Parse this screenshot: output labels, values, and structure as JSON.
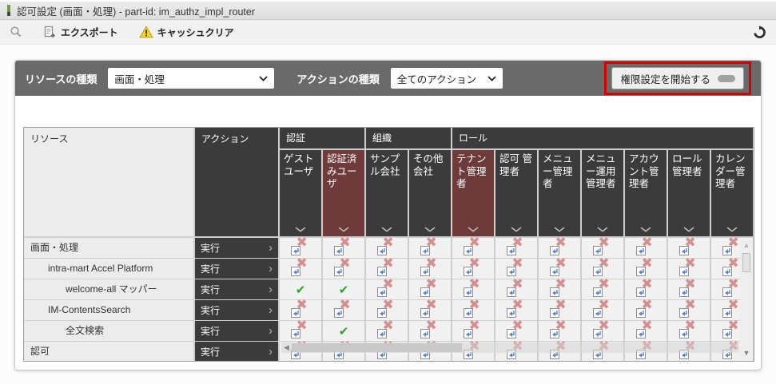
{
  "window": {
    "title": "認可設定 (画面・処理) - part-id: im_authz_impl_router"
  },
  "toolbar": {
    "export_label": "エクスポート",
    "cache_clear_label": "キャッシュクリア"
  },
  "filters": {
    "resource_type_label": "リソースの種類",
    "resource_type_value": "画面・処理",
    "action_type_label": "アクションの種類",
    "action_type_value": "全てのアクション",
    "start_button_label": "権限設定を開始する"
  },
  "table": {
    "resource_header": "リソース",
    "action_header": "アクション",
    "groups": [
      {
        "label": "認証",
        "columns": [
          {
            "label": "ゲストユーザ",
            "selected": false
          },
          {
            "label": "認証済みユーザ",
            "selected": true
          }
        ]
      },
      {
        "label": "組織",
        "columns": [
          {
            "label": "サンプル会社",
            "selected": false
          },
          {
            "label": "その他会社",
            "selected": false
          }
        ]
      },
      {
        "label": "ロール",
        "columns": [
          {
            "label": "テナント管理者",
            "selected": true
          },
          {
            "label": "認可 管理者",
            "selected": false
          },
          {
            "label": "メニュー管理者",
            "selected": false
          },
          {
            "label": "メニュー運用管理者",
            "selected": false
          },
          {
            "label": "アカウント管理者",
            "selected": false
          },
          {
            "label": "ロール管理者",
            "selected": false
          },
          {
            "label": "カレンダー管理者",
            "selected": false
          }
        ]
      }
    ],
    "rows": [
      {
        "resource": "画面・処理",
        "indent": 0,
        "action": "実行",
        "cells": [
          "deny",
          "deny",
          "deny",
          "deny",
          "deny",
          "deny",
          "deny",
          "deny",
          "deny",
          "deny",
          "deny"
        ]
      },
      {
        "resource": "intra-mart Accel Platform",
        "indent": 1,
        "action": "実行",
        "cells": [
          "deny",
          "deny",
          "deny",
          "deny",
          "deny",
          "deny",
          "deny",
          "deny",
          "deny",
          "deny",
          "deny"
        ]
      },
      {
        "resource": "welcome-all マッパー",
        "indent": 2,
        "action": "実行",
        "cells": [
          "allow",
          "allow",
          "deny",
          "deny",
          "deny",
          "deny",
          "deny",
          "deny",
          "deny",
          "deny",
          "deny"
        ]
      },
      {
        "resource": "IM-ContentsSearch",
        "indent": 1,
        "action": "実行",
        "cells": [
          "deny",
          "deny",
          "deny",
          "deny",
          "deny",
          "deny",
          "deny",
          "deny",
          "deny",
          "deny",
          "deny"
        ]
      },
      {
        "resource": "全文検索",
        "indent": 2,
        "action": "実行",
        "cells": [
          "deny",
          "allow",
          "deny",
          "deny",
          "deny",
          "deny",
          "deny",
          "deny",
          "deny",
          "deny",
          "deny"
        ]
      },
      {
        "resource": "認可",
        "indent": 0,
        "action": "実行",
        "cells": [
          "deny",
          "deny",
          "deny",
          "deny",
          "deny",
          "deny",
          "deny",
          "deny",
          "deny",
          "deny",
          "deny"
        ]
      }
    ]
  },
  "icons": {
    "allow_glyph": "✔",
    "deny_x_glyph": "✖"
  },
  "colors": {
    "header_dark": "#3b3b3b",
    "selected_column": "#6e3a3a",
    "allow_green": "#2ea12e",
    "deny_pink": "#d49090",
    "annotation_red": "#d40000",
    "filter_bar": "#6a6a6a",
    "warning_yellow": "#f8d71c"
  }
}
